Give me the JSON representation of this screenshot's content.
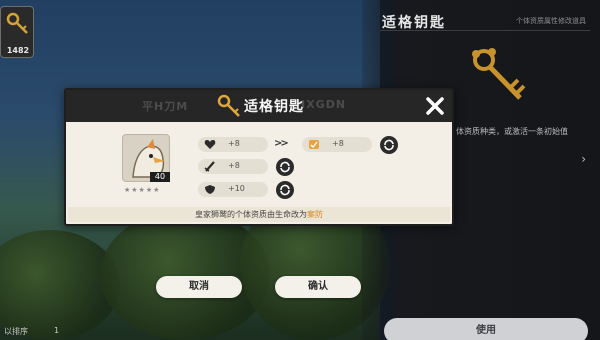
{
  "background": {
    "item_count": "1482",
    "sort_label": "以排序",
    "sort_label2": "1"
  },
  "right_panel": {
    "title": "适格钥匙",
    "subtitle": "个体资质属性修改道具",
    "description": "体资质种类，或激活一条初始值",
    "use_label": "使用",
    "icons": {
      "key": "golden-key-icon",
      "chevron": "chevron-right-icon"
    }
  },
  "modal": {
    "header_watermark": "平H刀M",
    "header_watermark2": "HXGDN",
    "title": "适格钥匙",
    "pal": {
      "level": "40",
      "stars": "★★★★★"
    },
    "current_stats": [
      {
        "icon": "heart-icon",
        "value": "+8"
      },
      {
        "icon": "sword-icon",
        "value": "+8"
      },
      {
        "icon": "shield-icon",
        "value": "+10"
      }
    ],
    "arrows": ">>",
    "new_stat": {
      "icon": "defense-badge-icon",
      "value": "+8"
    },
    "footer": {
      "prefix": "皇家狮鹫的个体资质由生命改为",
      "highlight": "案防"
    }
  },
  "buttons": {
    "cancel": "取消",
    "confirm": "确认"
  },
  "colors": {
    "accent": "#d9871a",
    "modal_bg": "#f3efe6",
    "header_bg": "#262626"
  }
}
